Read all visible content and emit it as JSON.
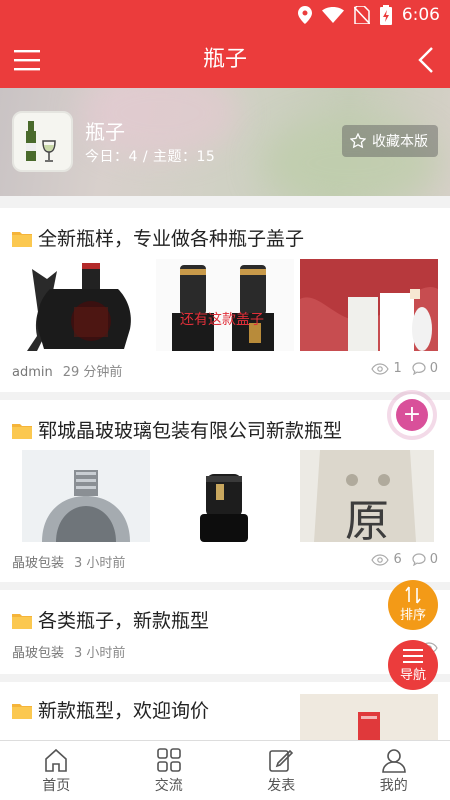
{
  "status": {
    "time": "6:06"
  },
  "header": {
    "title": "瓶子"
  },
  "forum": {
    "name": "瓶子",
    "stats": "今日：4 / 主题：15",
    "fav_label": "收藏本版"
  },
  "posts": [
    {
      "title": "全新瓶样，专业做各种瓶子盖子",
      "author": "admin",
      "time": "29 分钟前",
      "views": "1",
      "replies": "0",
      "thumb_caption": "还有这款盖子"
    },
    {
      "title": "郓城晶玻玻璃包装有限公司新款瓶型",
      "author": "晶玻包装",
      "time": "3 小时前",
      "views": "6",
      "replies": "0"
    },
    {
      "title": "各类瓶子，新款瓶型",
      "author": "晶玻包装",
      "time": "3 小时前"
    },
    {
      "title": "新款瓶型，欢迎询价"
    }
  ],
  "fab": {
    "sort": "排序",
    "nav": "导航"
  },
  "tabbar": [
    {
      "label": "首页"
    },
    {
      "label": "交流"
    },
    {
      "label": "发表"
    },
    {
      "label": "我的"
    }
  ],
  "colors": {
    "brand": "#eb3c3c",
    "sort": "#f39a17",
    "plus": "#d9509a"
  }
}
